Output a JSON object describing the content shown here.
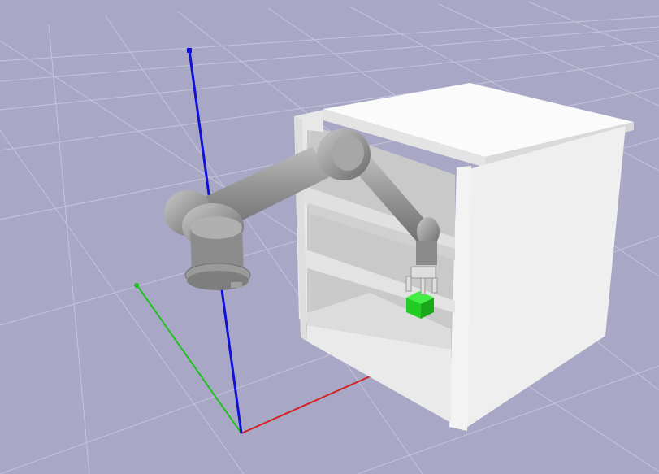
{
  "scene": {
    "background": "#a8a8c6",
    "grid_color": "#c4c4da",
    "axes": {
      "x": {
        "color": "#d42020"
      },
      "y": {
        "color": "#20c020"
      },
      "z": {
        "color": "#1010d8"
      }
    },
    "robot_arm_color": "#8e8e8e",
    "cabinet_color": "#f2f2f2",
    "target_object_color": "#22dd22"
  }
}
